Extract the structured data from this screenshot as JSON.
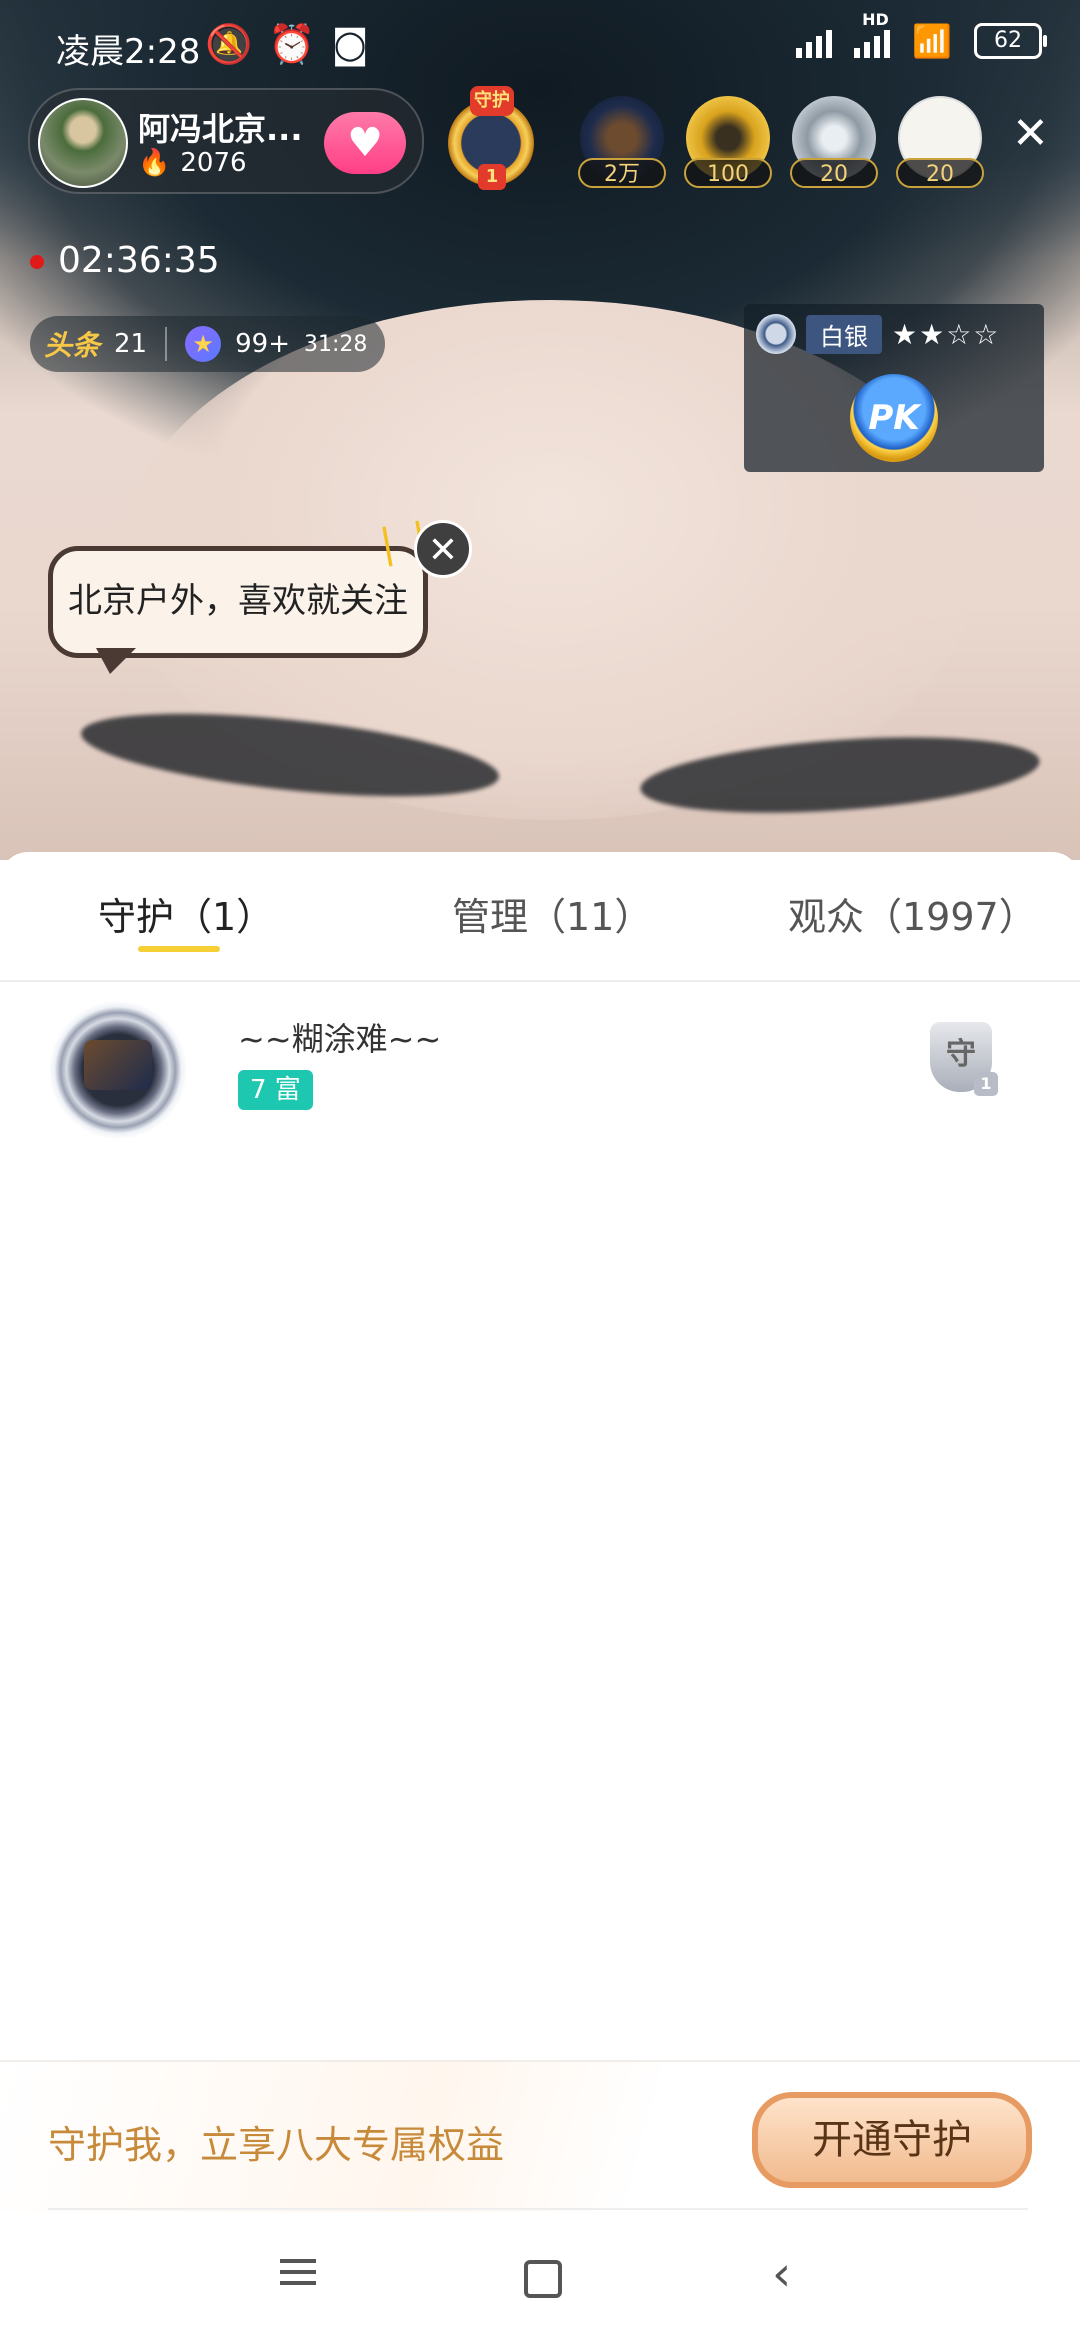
{
  "status_bar": {
    "time": "凌晨2:28",
    "battery": "62",
    "network": "HD"
  },
  "host": {
    "name": "阿冯北京...",
    "heat": "2076"
  },
  "guard_badge": {
    "label": "守护",
    "rank": "1"
  },
  "top_viewers": [
    {
      "count": "2万"
    },
    {
      "count": "100"
    },
    {
      "count": "20"
    },
    {
      "count": "20"
    }
  ],
  "live_timer": "02:36:35",
  "chips": {
    "headline_label": "头条",
    "headline_count": "21",
    "star_count": "99+",
    "star_time": "31:28"
  },
  "pk_panel": {
    "tier": "白银",
    "stars": "★★☆☆",
    "pk_label": "PK"
  },
  "bubble_text": "北京户外，喜欢就关注",
  "tabs": [
    {
      "label": "守护（1）",
      "active": true
    },
    {
      "label": "管理（11）",
      "active": false
    },
    {
      "label": "观众（1997）",
      "active": false
    }
  ],
  "guard_list": [
    {
      "name": "~~糊涂难~~",
      "level": "7 富",
      "badge": "守",
      "badge_num": "1"
    }
  ],
  "promo": {
    "text": "守护我，立享八大专属权益",
    "button": "开通守护"
  },
  "icons": {
    "close": "close-icon",
    "follow": "heart-icon",
    "flame": "flame-icon"
  }
}
